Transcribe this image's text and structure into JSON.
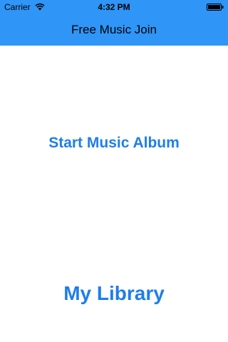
{
  "status_bar": {
    "carrier": "Carrier",
    "time": "4:32 PM",
    "wifi_icon": "wifi-icon",
    "battery_icon": "battery-icon"
  },
  "nav_bar": {
    "title": "Free Music Join",
    "background_color": "#2F95F7"
  },
  "main": {
    "start_album_label": "Start Music Album",
    "my_library_label": "My Library",
    "button_color": "#1E7EEA"
  }
}
